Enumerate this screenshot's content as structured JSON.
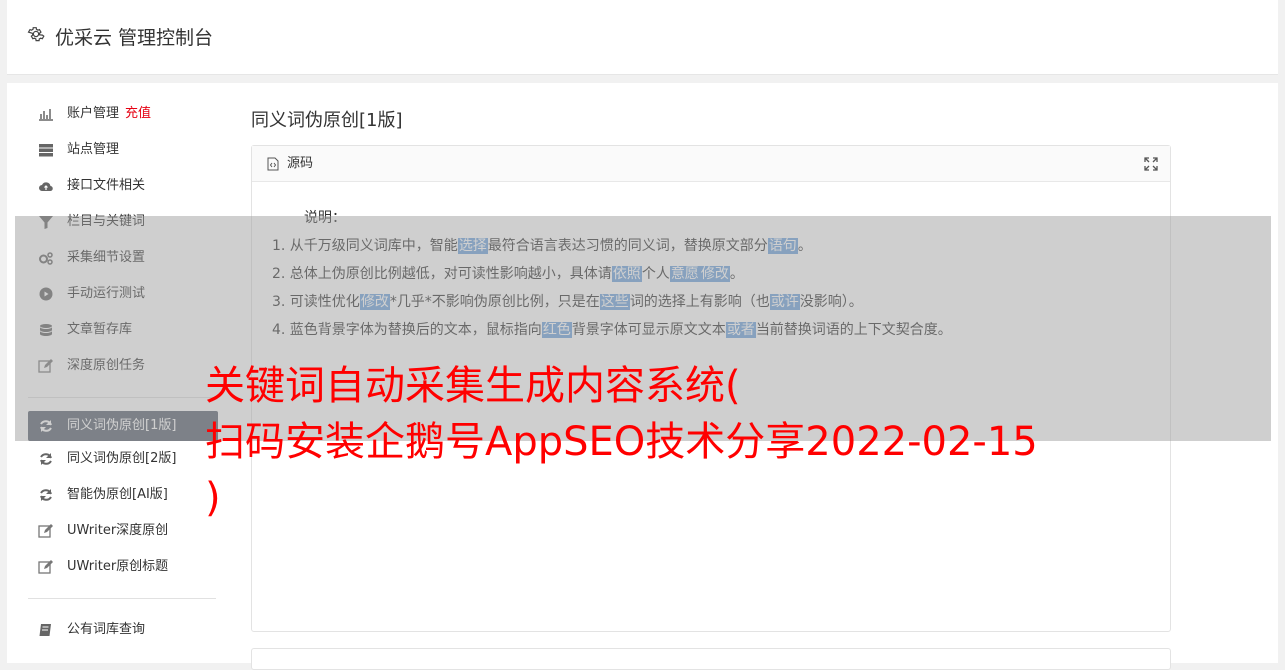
{
  "header": {
    "title": "优采云 管理控制台",
    "icon": "gear-icon"
  },
  "sidebar": {
    "group1": [
      {
        "label": "账户管理",
        "badge": "充值",
        "icon": "bar-chart-icon"
      },
      {
        "label": "站点管理",
        "icon": "server-icon"
      },
      {
        "label": "接口文件相关",
        "icon": "cloud-upload-icon"
      },
      {
        "label": "栏目与关键词",
        "icon": "filter-icon"
      },
      {
        "label": "采集细节设置",
        "icon": "cogs-icon"
      },
      {
        "label": "手动运行测试",
        "icon": "play-circle-icon"
      },
      {
        "label": "文章暂存库",
        "icon": "database-icon"
      },
      {
        "label": "深度原创任务",
        "icon": "edit-icon"
      }
    ],
    "group2": [
      {
        "label": "同义词伪原创[1版]",
        "icon": "refresh-icon",
        "active": true
      },
      {
        "label": "同义词伪原创[2版]",
        "icon": "refresh-icon"
      },
      {
        "label": "智能伪原创[AI版]",
        "icon": "refresh-icon"
      },
      {
        "label": "UWriter深度原创",
        "icon": "edit-icon"
      },
      {
        "label": "UWriter原创标题",
        "icon": "edit-icon"
      }
    ],
    "group3": [
      {
        "label": "公有词库查询",
        "icon": "book-icon"
      }
    ]
  },
  "main": {
    "title": "同义词伪原创[1版]",
    "card": {
      "header_label": "源码",
      "desc_title": "说明：",
      "lines": [
        [
          "1. 从千万级同义词库中，智能",
          {
            "hl": "选择"
          },
          "最符合语言表达习惯的同义词，替换原文部分",
          {
            "hl": "语句"
          },
          "。"
        ],
        [
          "2. 总体上伪原创比例越低，对可读性影响越小，具体请",
          {
            "hl": "依照"
          },
          "个人",
          {
            "hl": "意愿"
          },
          {
            "hl": "修改"
          },
          "。"
        ],
        [
          "3. 可读性优化",
          {
            "hl": "修改"
          },
          "*几乎*不影响伪原创比例，只是在",
          {
            "hl": "这些"
          },
          "词的选择上有影响（也",
          {
            "hl": "或许"
          },
          "没影响）。"
        ],
        [
          "4. 蓝色背景字体为替换后的文本，鼠标指向",
          {
            "hl": "红色"
          },
          "背景字体可显示原文文本",
          {
            "hl": "或者"
          },
          "当前替换词语的上下文契合度。"
        ]
      ]
    }
  },
  "overlay": {
    "lines": [
      "关键词自动采集生成内容系统(",
      "扫码安装企鹅号AppSEO技术分享2022-02-15",
      ")"
    ],
    "color": "#ff0000"
  }
}
